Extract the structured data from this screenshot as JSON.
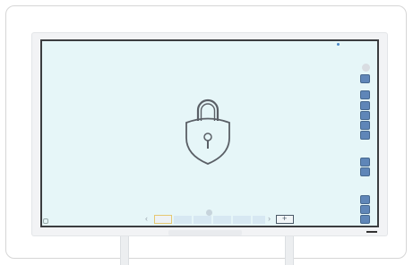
{
  "scene": {
    "screen_color": "#e6f6f8",
    "frame_color": "#f2f3f5",
    "bezel_color": "#3b3d40",
    "accent_color": "#5f86b8",
    "active_page_color": "#e5c872"
  },
  "icons": {
    "center": "lock-icon",
    "sidebar": [
      "more-icon",
      "pen-icon",
      "tool-icon",
      "tool-icon",
      "tool-icon",
      "tool-icon",
      "tool-icon",
      "tool-icon",
      "tool-icon",
      "tool-icon",
      "tool-icon"
    ],
    "bottom": [
      "chevron-left-icon",
      "chevron-right-icon",
      "add-page-icon"
    ]
  },
  "bottom_bar": {
    "left_chevron": "‹",
    "right_chevron": "›",
    "add_label": "+"
  }
}
